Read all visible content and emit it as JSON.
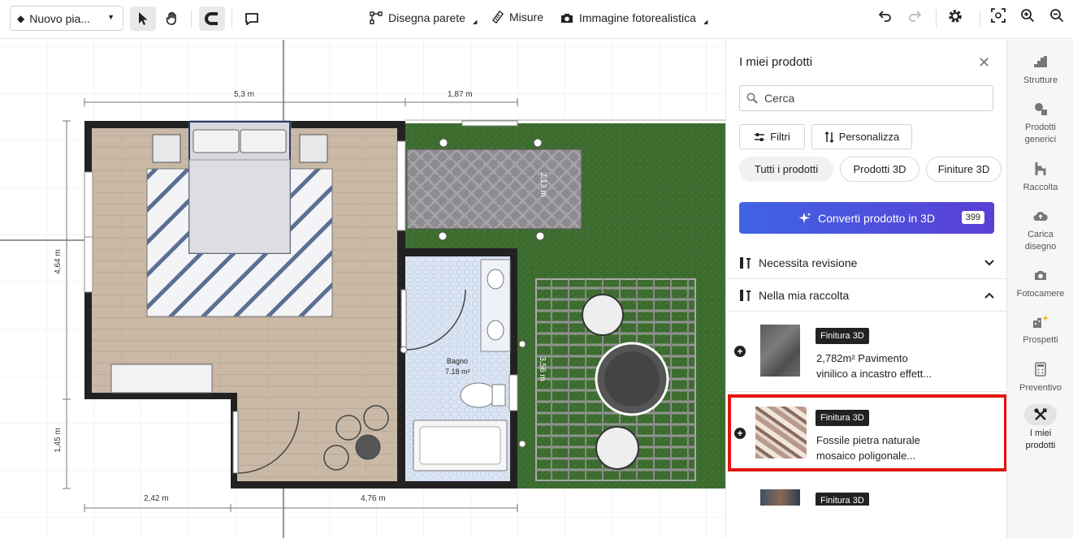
{
  "toolbar": {
    "plan_name": "Nuovo pia...",
    "draw_wall": "Disegna parete",
    "measures": "Misure",
    "photo_image": "Immagine fotorealistica"
  },
  "canvas": {
    "dim_top_1": "5,3 m",
    "dim_top_2": "1,87 m",
    "dim_left_1": "4,64 m",
    "dim_left_2": "1,45 m",
    "dim_bottom_1": "2,42 m",
    "dim_bottom_2": "4,76 m",
    "dim_patio_1": "2,13 m",
    "dim_pergola": "3,56 m",
    "room_name": "Bagno",
    "room_area": "7.18 m²"
  },
  "panel": {
    "title": "I miei prodotti",
    "search_placeholder": "Cerca",
    "filters_label": "Filtri",
    "customize_label": "Personalizza",
    "chips": [
      "Tutti i prodotti",
      "Prodotti 3D",
      "Finiture 3D"
    ],
    "convert_label": "Converti prodotto in 3D",
    "convert_count": "399",
    "section_review": "Necessita revisione",
    "section_collection": "Nella mia raccolta",
    "products": [
      {
        "tag": "Finitura 3D",
        "name_line1": "2,782m² Pavimento",
        "name_line2": "vinilico a incastro effett..."
      },
      {
        "tag": "Finitura 3D",
        "name_line1": "Fossile pietra naturale",
        "name_line2": "mosaico poligonale..."
      },
      {
        "tag": "Finitura 3D"
      }
    ]
  },
  "rail": {
    "items": [
      {
        "line1": "Strutture",
        "line2": ""
      },
      {
        "line1": "Prodotti",
        "line2": "generici"
      },
      {
        "line1": "Raccolta",
        "line2": ""
      },
      {
        "line1": "Carica",
        "line2": "disegno"
      },
      {
        "line1": "Fotocamere",
        "line2": ""
      },
      {
        "line1": "Prospetti",
        "line2": ""
      },
      {
        "line1": "Preventivo",
        "line2": ""
      },
      {
        "line1": "I miei",
        "line2": "prodotti"
      }
    ]
  },
  "colors": {
    "accent_gradient_start": "#3f64e3",
    "accent_gradient_end": "#5a3fd6",
    "highlight": "#e3140e",
    "grass": "#3c6b2f"
  }
}
